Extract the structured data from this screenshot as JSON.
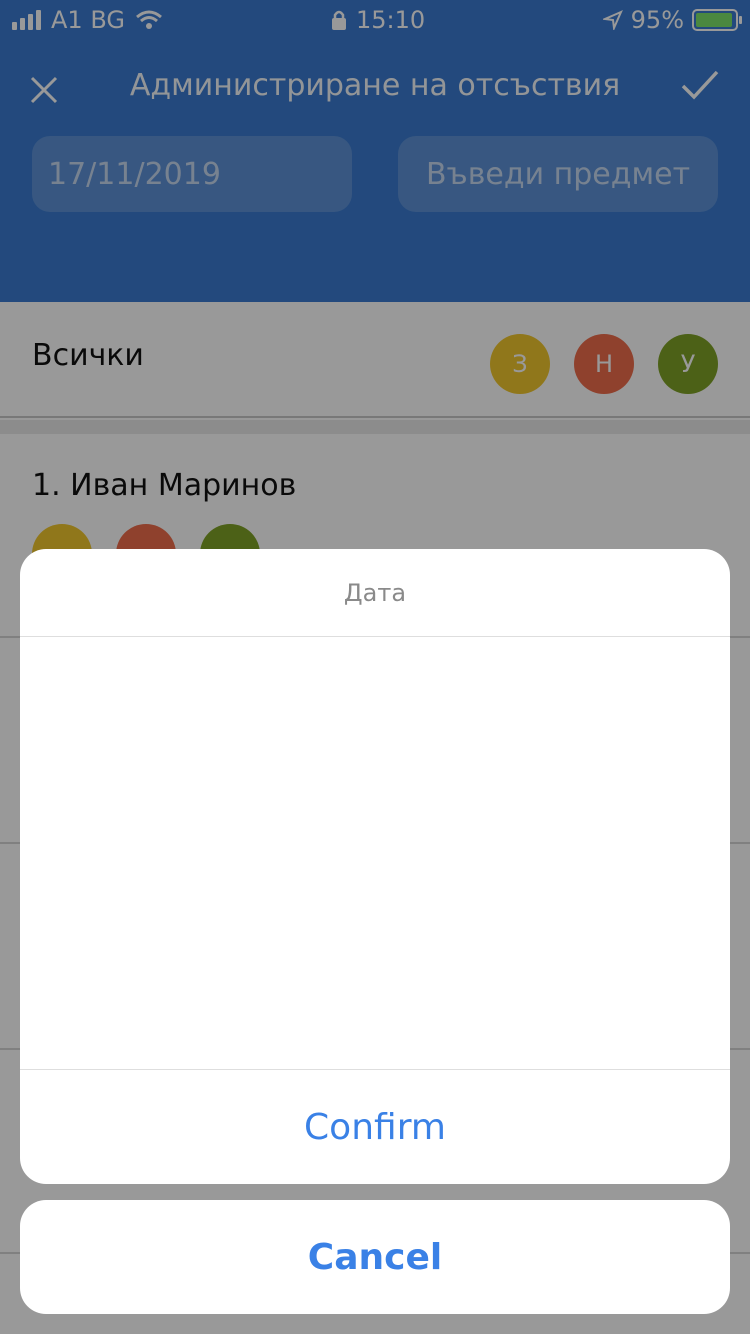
{
  "status_bar": {
    "carrier": "A1 BG",
    "time": "15:10",
    "battery_percent": "95%",
    "battery_level": 0.95
  },
  "header": {
    "title": "Администриране на отсъствия",
    "date_value": "17/11/2019",
    "subject_placeholder": "Въведи предмет",
    "close_icon": "close-icon",
    "confirm_icon": "check-icon"
  },
  "all_row": {
    "label": "Всички",
    "badges": [
      "З",
      "Н",
      "У"
    ]
  },
  "students": [
    {
      "name": "1. Иван Маринов"
    }
  ],
  "picker_sheet": {
    "title": "Дата",
    "confirm_label": "Confirm"
  },
  "cancel_sheet": {
    "cancel_label": "Cancel"
  },
  "colors": {
    "header": "#3b7bd0",
    "badge_z": "#f1c62e",
    "badge_n": "#ef6d4b",
    "badge_u": "#7fa227",
    "action": "#3a81e6"
  }
}
